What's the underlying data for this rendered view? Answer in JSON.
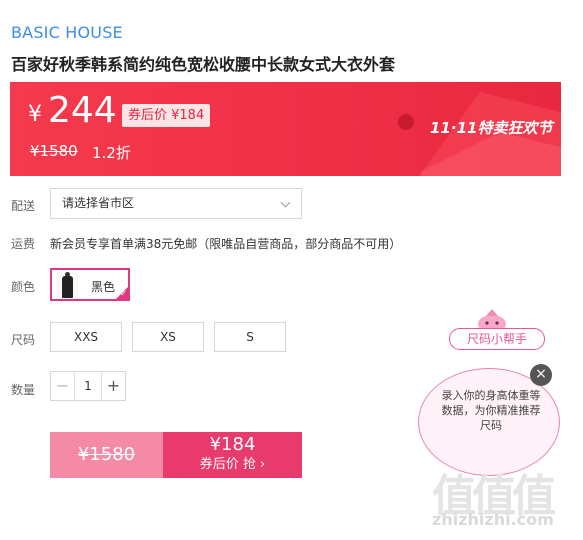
{
  "product": {
    "brand": "BASIC HOUSE",
    "title": "百家好秋季韩系简约纯色宽松收腰中长款女式大衣外套"
  },
  "price_banner": {
    "currency": "¥",
    "price": "244",
    "coupon_price_label": "券后价 ¥184",
    "original_price": "¥1580",
    "discount": "1.2折",
    "event_label": "11·11特卖狂欢节",
    "colors": {
      "start": "#f53a4d",
      "end": "#e8283f"
    }
  },
  "delivery": {
    "label": "配送",
    "placeholder": "请选择省市区"
  },
  "shipping": {
    "label": "运费",
    "text": "新会员专享首单满38元免邮（限唯品自营商品，部分商品不可用）"
  },
  "color": {
    "label": "颜色",
    "selected": "黑色",
    "accent": "#e13680"
  },
  "size": {
    "label": "尺码",
    "options": [
      "XXS",
      "XS",
      "S"
    ]
  },
  "quantity": {
    "label": "数量",
    "minus": "−",
    "value": "1",
    "plus": "+"
  },
  "buy": {
    "original_price": "¥1580",
    "coupon_price": "¥184",
    "action": "券后价 抢 ›"
  },
  "size_helper": {
    "tag": "尺码小帮手",
    "bubble_text": "录入你的身高体重等数据，为你精准推荐尺码",
    "close": "×"
  },
  "watermark": {
    "logo": "值值值",
    "url": "zhizhizhi.com"
  }
}
